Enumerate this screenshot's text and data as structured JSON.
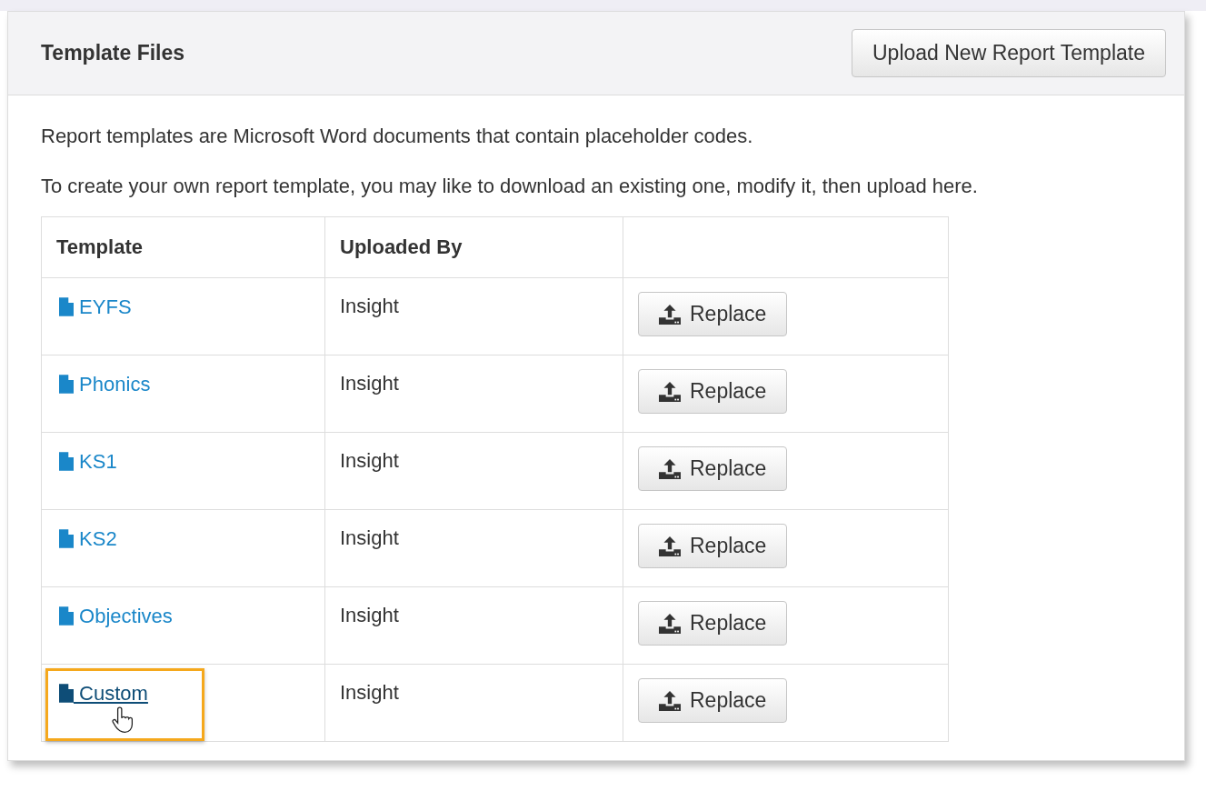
{
  "panel": {
    "title": "Template Files",
    "upload_button": "Upload New Report Template"
  },
  "intro": [
    "Report templates are Microsoft Word documents that contain placeholder codes.",
    "To create your own report template, you may like to download an existing one, modify it, then upload here."
  ],
  "table": {
    "columns": [
      "Template",
      "Uploaded By"
    ],
    "rows": [
      {
        "template": "EYFS",
        "uploaded_by": "Insight",
        "action": "Replace",
        "hovered": false
      },
      {
        "template": "Phonics",
        "uploaded_by": "Insight",
        "action": "Replace",
        "hovered": false
      },
      {
        "template": "KS1",
        "uploaded_by": "Insight",
        "action": "Replace",
        "hovered": false
      },
      {
        "template": "KS2",
        "uploaded_by": "Insight",
        "action": "Replace",
        "hovered": false
      },
      {
        "template": "Objectives",
        "uploaded_by": "Insight",
        "action": "Replace",
        "hovered": false
      },
      {
        "template": "Custom",
        "uploaded_by": "Insight",
        "action": "Replace",
        "hovered": true
      }
    ]
  }
}
